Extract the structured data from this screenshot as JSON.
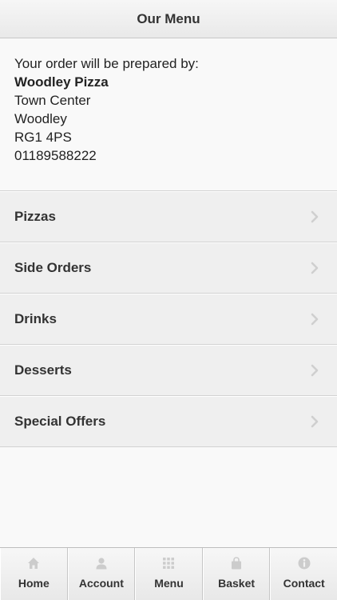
{
  "header": {
    "title": "Our Menu"
  },
  "store": {
    "intro": "Your order will be prepared by:",
    "name": "Woodley Pizza",
    "address_line1": "Town Center",
    "address_line2": "Woodley",
    "postcode": "RG1 4PS",
    "phone": "01189588222"
  },
  "menu": {
    "items": [
      {
        "label": "Pizzas",
        "icon": "chevron-right-icon"
      },
      {
        "label": "Side Orders",
        "icon": "chevron-right-icon"
      },
      {
        "label": "Drinks",
        "icon": "chevron-right-icon"
      },
      {
        "label": "Desserts",
        "icon": "chevron-right-icon"
      },
      {
        "label": "Special Offers",
        "icon": "chevron-right-icon"
      }
    ]
  },
  "tabbar": {
    "tabs": [
      {
        "label": "Home",
        "icon": "home-icon"
      },
      {
        "label": "Account",
        "icon": "user-icon"
      },
      {
        "label": "Menu",
        "icon": "grid-icon"
      },
      {
        "label": "Basket",
        "icon": "basket-icon"
      },
      {
        "label": "Contact",
        "icon": "info-icon"
      }
    ]
  },
  "colors": {
    "background": "#f9f9f9",
    "list_item": "#efefef",
    "text": "#333333",
    "icon": "#c8c8c8"
  }
}
